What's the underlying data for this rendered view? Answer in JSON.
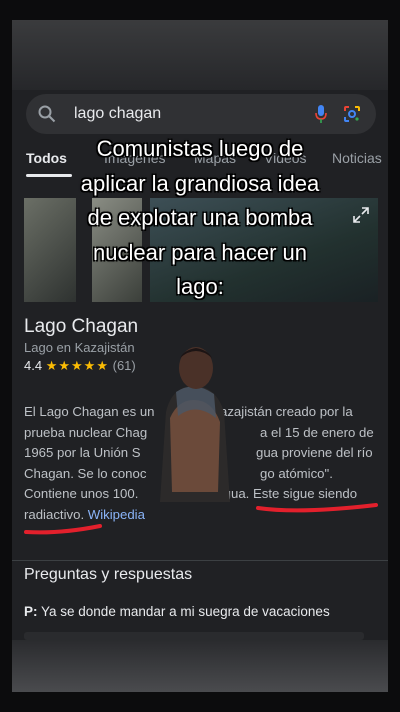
{
  "search": {
    "query": "lago chagan"
  },
  "tabs": [
    {
      "label": "Todos"
    },
    {
      "label": "Imágenes"
    },
    {
      "label": "Mapas"
    },
    {
      "label": "Videos"
    },
    {
      "label": "Noticias"
    }
  ],
  "caption": {
    "lines": [
      "Comunistas luego de",
      "aplicar la grandiosa idea",
      "de explotar una bomba",
      "nuclear para hacer un",
      "lago:"
    ]
  },
  "knowledge_panel": {
    "title": "Lago Chagan",
    "subtitle": "Lago en Kazajistán",
    "rating": "4.4",
    "stars": "★★★★★",
    "reviews": "(61)",
    "description_lines": [
      "El Lago Chagan es un",
      "azajistán creado por la",
      "prueba nuclear Chag",
      "a el 15 de enero de",
      "1965 por la Unión S",
      "gua proviene del río",
      "Chagan. Se lo conoc",
      "go atómico\".",
      "Contiene unos 100.",
      "de agua. Este sigue siendo",
      "radiactivo."
    ],
    "source_link": "Wikipedia"
  },
  "faq": {
    "title": "Preguntas y respuestas",
    "prefix": "P:",
    "question": "Ya se donde mandar a mi suegra de vacaciones"
  },
  "colors": {
    "background": "#202124",
    "link": "#8ab4f8",
    "star": "#fbbc04",
    "underline": "#e3202c"
  }
}
